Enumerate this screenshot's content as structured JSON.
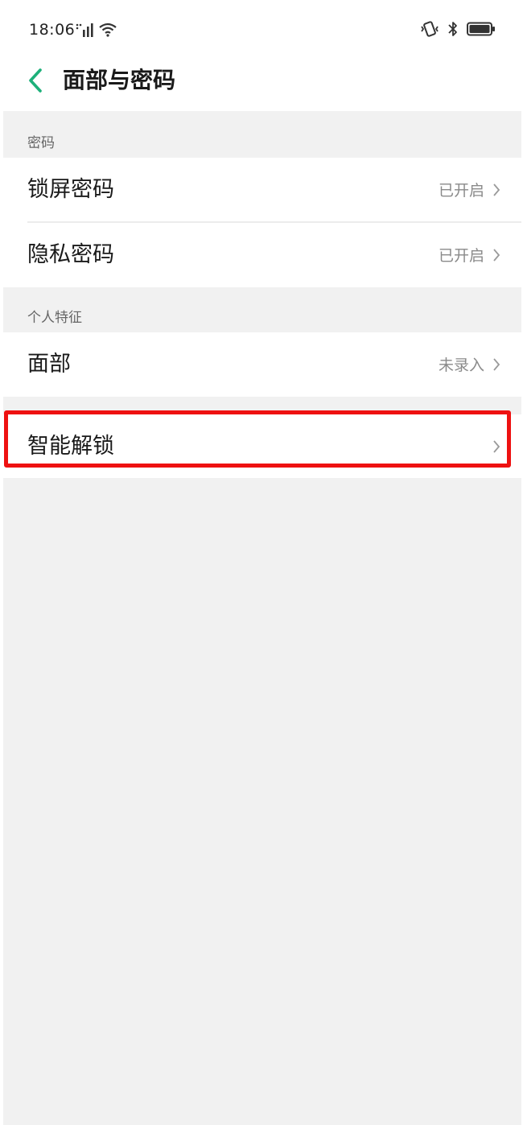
{
  "status_bar": {
    "time": "18:06",
    "icons": [
      "signal-icon",
      "wifi-icon",
      "vibrate-icon",
      "bluetooth-icon",
      "battery-icon"
    ]
  },
  "header": {
    "title": "面部与密码",
    "back_icon": "chevron-left-icon"
  },
  "sections": {
    "password": {
      "label": "密码",
      "items": [
        {
          "label": "锁屏密码",
          "value": "已开启"
        },
        {
          "label": "隐私密码",
          "value": "已开启"
        }
      ]
    },
    "biometrics": {
      "label": "个人特征",
      "items": [
        {
          "label": "面部",
          "value": "未录入"
        }
      ]
    },
    "smart": {
      "items": [
        {
          "label": "智能解锁",
          "value": ""
        }
      ]
    }
  },
  "colors": {
    "accent": "#1db07a",
    "highlight": "#ee1111",
    "background_gray": "#f1f1f1",
    "secondary_text": "#8a8a8a"
  }
}
